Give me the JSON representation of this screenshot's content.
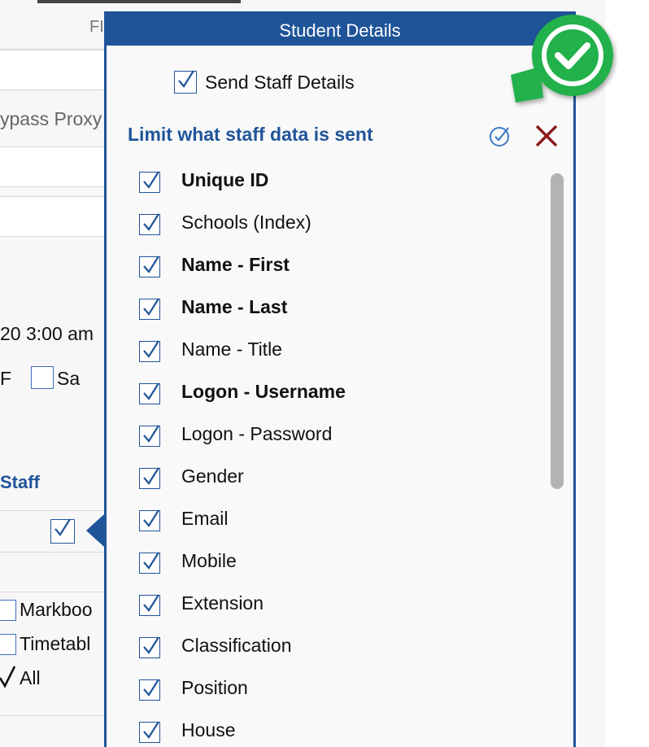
{
  "background": {
    "fragment_top": "FI",
    "bypass_proxy_label": "ypass Proxy",
    "time_text": "20 3:00 am",
    "day_f": "F",
    "day_sa": "Sa",
    "staff_heading": "Staff",
    "options": [
      {
        "label": "Markboo",
        "checked": false
      },
      {
        "label": "Timetabl",
        "checked": false
      },
      {
        "label": "All",
        "checked": true
      }
    ]
  },
  "popup": {
    "title": "Student Details",
    "send_staff_label": "Send Staff Details",
    "send_staff_checked": true,
    "limit_title": "Limit what staff data is sent",
    "fields": [
      {
        "label": "Unique ID",
        "bold": true,
        "checked": true
      },
      {
        "label": "Schools (Index)",
        "bold": false,
        "checked": true
      },
      {
        "label": "Name - First",
        "bold": true,
        "checked": true
      },
      {
        "label": "Name - Last",
        "bold": true,
        "checked": true
      },
      {
        "label": "Name - Title",
        "bold": false,
        "checked": true
      },
      {
        "label": "Logon - Username",
        "bold": true,
        "checked": true
      },
      {
        "label": "Logon - Password",
        "bold": false,
        "checked": true
      },
      {
        "label": "Gender",
        "bold": false,
        "checked": true
      },
      {
        "label": "Email",
        "bold": false,
        "checked": true
      },
      {
        "label": "Mobile",
        "bold": false,
        "checked": true
      },
      {
        "label": "Extension",
        "bold": false,
        "checked": true
      },
      {
        "label": "Classification",
        "bold": false,
        "checked": true
      },
      {
        "label": "Position",
        "bold": false,
        "checked": true
      },
      {
        "label": "House",
        "bold": false,
        "checked": true
      }
    ]
  },
  "colors": {
    "accent": "#1f5499",
    "close": "#8b1a1a",
    "badge": "#22b14c"
  }
}
